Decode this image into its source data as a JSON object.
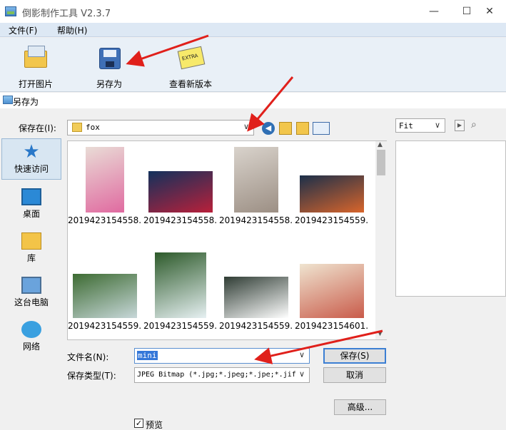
{
  "window": {
    "title": "倒影制作工具 V2.3.7",
    "minimize": "—",
    "maximize": "☐",
    "close": "✕"
  },
  "menu": {
    "file": "文件(F)",
    "help": "帮助(H)"
  },
  "toolbar": {
    "open": "打开图片",
    "save_as": "另存为",
    "check_update": "查看新版本"
  },
  "dialog": {
    "title": "另存为",
    "save_in_label": "保存在(I):",
    "save_in_value": "fox",
    "places": [
      "快速访问",
      "桌面",
      "库",
      "这台电脑",
      "网络"
    ],
    "files": [
      {
        "name": "2019423154558...",
        "color_a": "#e9dcd6",
        "color_b": "#e06aa0"
      },
      {
        "name": "2019423154558...",
        "color_a": "#12315c",
        "color_b": "#b9203a"
      },
      {
        "name": "2019423154558...",
        "color_a": "#d9d3cc",
        "color_b": "#9c8f84"
      },
      {
        "name": "2019423154559...",
        "color_a": "#1b2f4a",
        "color_b": "#d9652b"
      },
      {
        "name": "2019423154559...",
        "color_a": "#3d6b32",
        "color_b": "#c7d7d9"
      },
      {
        "name": "2019423154559...",
        "color_a": "#2d5a2a",
        "color_b": "#e6f0f2"
      },
      {
        "name": "2019423154559...",
        "color_a": "#2f3c34",
        "color_b": "#ffffff"
      },
      {
        "name": "2019423154601...",
        "color_a": "#efe4d0",
        "color_b": "#c95b4a"
      }
    ],
    "filename_label": "文件名(N):",
    "filename_value": "mini",
    "filetype_label": "保存类型(T):",
    "filetype_value": "JPEG Bitmap (*.jpg;*.jpeg;*.jpe;*.jif",
    "save_button": "保存(S)",
    "cancel_button": "取消",
    "advanced_button": "高级...",
    "preview_label": "预览",
    "preview_checked": true,
    "fit_value": "Fit"
  },
  "colors": {
    "accent": "#3c7fd3",
    "annotation": "#e0201b"
  }
}
